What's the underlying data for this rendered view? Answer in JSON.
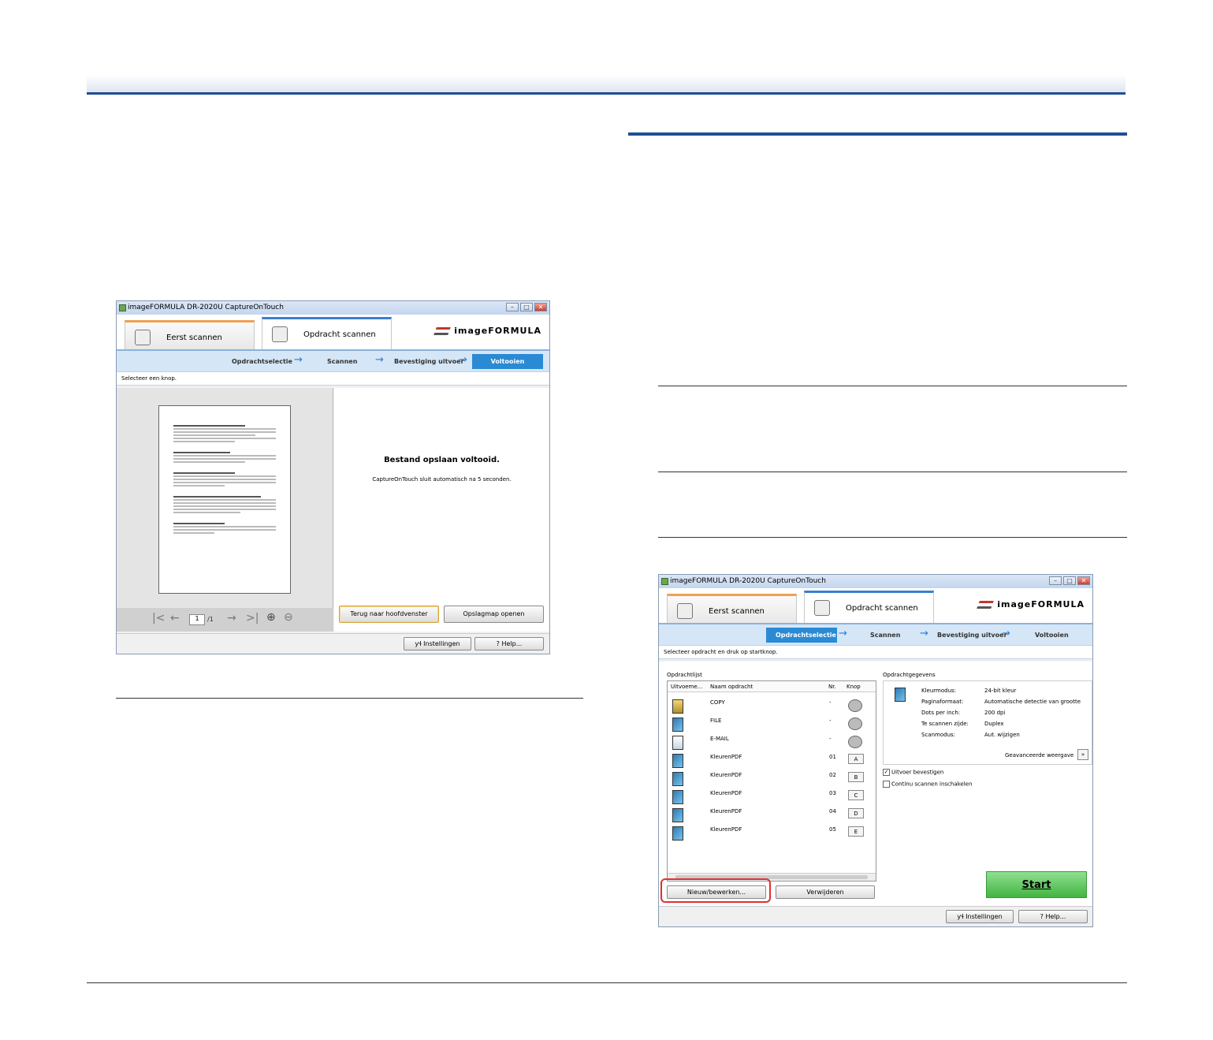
{
  "window1": {
    "title": "imageFORMULA DR-2020U CaptureOnTouch",
    "tab_first": "Eerst scannen",
    "tab_job": "Opdracht scannen",
    "brand": "imageFORMULA",
    "steps": [
      "Opdrachtselectie",
      "Scannen",
      "Bevestiging uitvoer",
      "Voltooien"
    ],
    "active_step": "Voltooien",
    "message": "Selecteer een knop.",
    "done_title": "Bestand opslaan voltooid.",
    "done_sub": "CaptureOnTouch sluit automatisch na 5 seconden.",
    "page_value": "1",
    "page_total": "/1",
    "btn_back": "Terug naar hoofdvenster",
    "btn_open": "Opslagmap openen",
    "btn_settings": "Instellingen",
    "btn_help": "Help..."
  },
  "window2": {
    "title": "imageFORMULA DR-2020U CaptureOnTouch",
    "tab_first": "Eerst scannen",
    "tab_job": "Opdracht scannen",
    "brand": "imageFORMULA",
    "steps": [
      "Opdrachtselectie",
      "Scannen",
      "Bevestiging uitvoer",
      "Voltooien"
    ],
    "active_step": "Opdrachtselectie",
    "message": "Selecteer opdracht en druk op startknop.",
    "list_label": "Opdrachtlijst",
    "details_label": "Opdrachtgegevens",
    "columns": [
      "Uitvoeme...",
      "Naam opdracht",
      "Nr.",
      "Knop"
    ],
    "rows": [
      {
        "name": "COPY",
        "nr": "-",
        "knop": ""
      },
      {
        "name": "FILE",
        "nr": "-",
        "knop": ""
      },
      {
        "name": "E-MAIL",
        "nr": "-",
        "knop": ""
      },
      {
        "name": "KleurenPDF",
        "nr": "01",
        "knop": "A"
      },
      {
        "name": "KleurenPDF",
        "nr": "02",
        "knop": "B"
      },
      {
        "name": "KleurenPDF",
        "nr": "03",
        "knop": "C"
      },
      {
        "name": "KleurenPDF",
        "nr": "04",
        "knop": "D"
      },
      {
        "name": "KleurenPDF",
        "nr": "05",
        "knop": "E"
      }
    ],
    "details": [
      {
        "label": "Kleurmodus:",
        "value": "24-bit kleur"
      },
      {
        "label": "Paginaformaat:",
        "value": "Automatische detectie van grootte"
      },
      {
        "label": "Dots per inch:",
        "value": "200 dpi"
      },
      {
        "label": "Te scannen zijde:",
        "value": "Duplex"
      },
      {
        "label": "Scanmodus:",
        "value": "Aut. wijzigen"
      }
    ],
    "advanced": "Geavanceerde weergave",
    "chk_confirm": "Uitvoer bevestigen",
    "chk_continuous": "Continu scannen inschakelen",
    "btn_new": "Nieuw/bewerken...",
    "btn_delete": "Verwijderen",
    "btn_start": "Start",
    "btn_settings": "Instellingen",
    "btn_help": "Help..."
  }
}
